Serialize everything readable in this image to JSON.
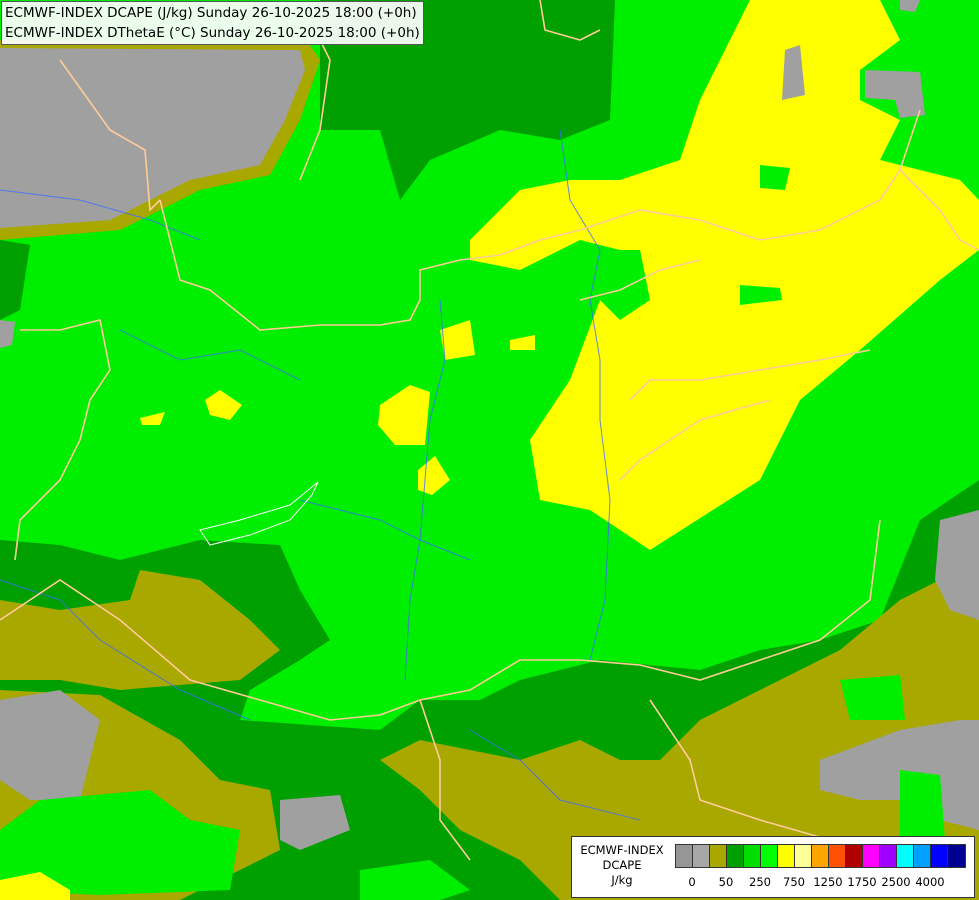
{
  "header": {
    "line1": "ECMWF-INDEX DCAPE (J/kg) Sunday 26-10-2025 18:00 (+0h)",
    "line2": "ECMWF-INDEX DThetaE (°C) Sunday 26-10-2025 18:00 (+0h)"
  },
  "legend": {
    "line1": "ECMWF-INDEX",
    "line2": "DCAPE",
    "line3": "J/kg",
    "colors": [
      "#969696",
      "#a7a7a7",
      "#a8a800",
      "#00a000",
      "#00dd00",
      "#00ff00",
      "#ffff00",
      "#ffff99",
      "#ffa500",
      "#ff5000",
      "#b00000",
      "#ff00ff",
      "#a000ff",
      "#00ffff",
      "#00a0ff",
      "#0000ff",
      "#000090"
    ],
    "ticks": [
      "0",
      "50",
      "250",
      "750",
      "1250",
      "1750",
      "2500",
      "4000"
    ]
  },
  "map_colors": {
    "gray": "#a0a0a0",
    "olive": "#a8a800",
    "dark_green": "#00a000",
    "green": "#00e000",
    "bright_green": "#00ff00",
    "yellow": "#ffff00",
    "border": "#ffcc99",
    "river": "#3c6cff"
  }
}
